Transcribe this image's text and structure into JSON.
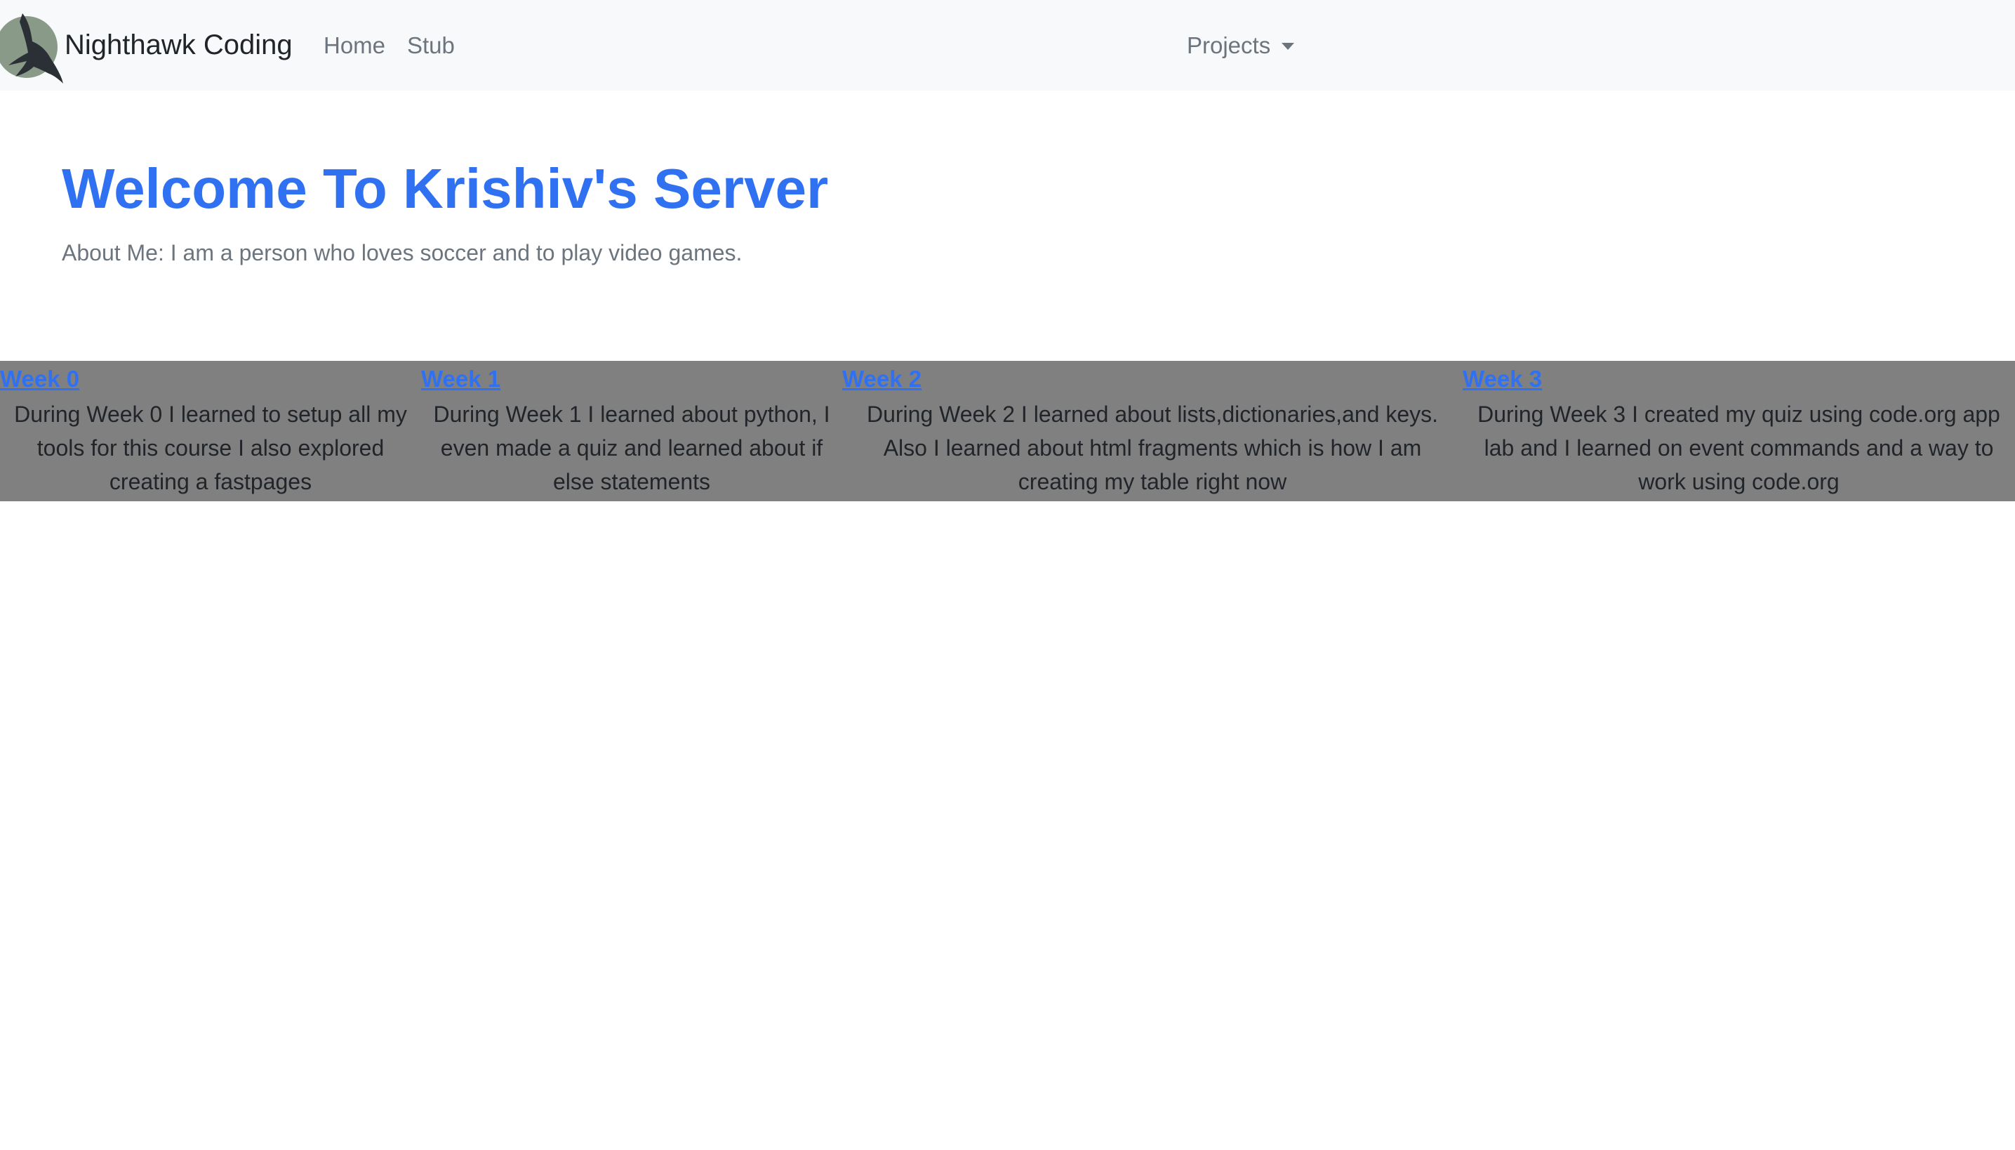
{
  "navbar": {
    "brand": "Nighthawk Coding",
    "logo_icon": "nighthawk-logo-icon",
    "links": [
      {
        "label": "Home"
      },
      {
        "label": "Stub"
      }
    ],
    "projects_label": "Projects"
  },
  "hero": {
    "title": "Welcome To Krishiv's Server",
    "subtitle": "About Me: I am a person who loves soccer and to play video games."
  },
  "weeks": [
    {
      "label": "Week 0",
      "description": "During Week 0 I learned to setup all my tools for this course I also explored creating a fastpages"
    },
    {
      "label": "Week 1",
      "description": "During Week 1 I learned about python, I even made a quiz and learned about if else statements"
    },
    {
      "label": "Week 2",
      "description": "During Week 2 I learned about lists,dictionaries,and keys. Also I learned about html fragments which is how I am creating my table right now"
    },
    {
      "label": "Week 3",
      "description": "During Week 3 I created my quiz using code.org app lab and I learned on event commands and a way to work using code.org"
    }
  ],
  "colors": {
    "accent": "#3071f2",
    "navbar_bg": "#f8f9fa",
    "table_bg": "#808080"
  }
}
